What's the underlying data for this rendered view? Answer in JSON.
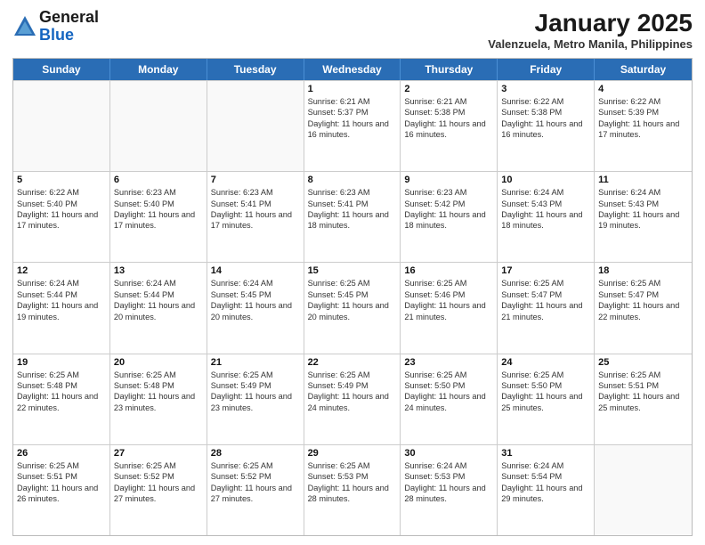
{
  "header": {
    "logo_line1": "General",
    "logo_line2": "Blue",
    "month_year": "January 2025",
    "location": "Valenzuela, Metro Manila, Philippines"
  },
  "days_of_week": [
    "Sunday",
    "Monday",
    "Tuesday",
    "Wednesday",
    "Thursday",
    "Friday",
    "Saturday"
  ],
  "weeks": [
    [
      {
        "day": "",
        "empty": true
      },
      {
        "day": "",
        "empty": true
      },
      {
        "day": "",
        "empty": true
      },
      {
        "day": "1",
        "sunrise": "6:21 AM",
        "sunset": "5:37 PM",
        "daylight": "11 hours and 16 minutes."
      },
      {
        "day": "2",
        "sunrise": "6:21 AM",
        "sunset": "5:38 PM",
        "daylight": "11 hours and 16 minutes."
      },
      {
        "day": "3",
        "sunrise": "6:22 AM",
        "sunset": "5:38 PM",
        "daylight": "11 hours and 16 minutes."
      },
      {
        "day": "4",
        "sunrise": "6:22 AM",
        "sunset": "5:39 PM",
        "daylight": "11 hours and 17 minutes."
      }
    ],
    [
      {
        "day": "5",
        "sunrise": "6:22 AM",
        "sunset": "5:40 PM",
        "daylight": "11 hours and 17 minutes."
      },
      {
        "day": "6",
        "sunrise": "6:23 AM",
        "sunset": "5:40 PM",
        "daylight": "11 hours and 17 minutes."
      },
      {
        "day": "7",
        "sunrise": "6:23 AM",
        "sunset": "5:41 PM",
        "daylight": "11 hours and 17 minutes."
      },
      {
        "day": "8",
        "sunrise": "6:23 AM",
        "sunset": "5:41 PM",
        "daylight": "11 hours and 18 minutes."
      },
      {
        "day": "9",
        "sunrise": "6:23 AM",
        "sunset": "5:42 PM",
        "daylight": "11 hours and 18 minutes."
      },
      {
        "day": "10",
        "sunrise": "6:24 AM",
        "sunset": "5:43 PM",
        "daylight": "11 hours and 18 minutes."
      },
      {
        "day": "11",
        "sunrise": "6:24 AM",
        "sunset": "5:43 PM",
        "daylight": "11 hours and 19 minutes."
      }
    ],
    [
      {
        "day": "12",
        "sunrise": "6:24 AM",
        "sunset": "5:44 PM",
        "daylight": "11 hours and 19 minutes."
      },
      {
        "day": "13",
        "sunrise": "6:24 AM",
        "sunset": "5:44 PM",
        "daylight": "11 hours and 20 minutes."
      },
      {
        "day": "14",
        "sunrise": "6:24 AM",
        "sunset": "5:45 PM",
        "daylight": "11 hours and 20 minutes."
      },
      {
        "day": "15",
        "sunrise": "6:25 AM",
        "sunset": "5:45 PM",
        "daylight": "11 hours and 20 minutes."
      },
      {
        "day": "16",
        "sunrise": "6:25 AM",
        "sunset": "5:46 PM",
        "daylight": "11 hours and 21 minutes."
      },
      {
        "day": "17",
        "sunrise": "6:25 AM",
        "sunset": "5:47 PM",
        "daylight": "11 hours and 21 minutes."
      },
      {
        "day": "18",
        "sunrise": "6:25 AM",
        "sunset": "5:47 PM",
        "daylight": "11 hours and 22 minutes."
      }
    ],
    [
      {
        "day": "19",
        "sunrise": "6:25 AM",
        "sunset": "5:48 PM",
        "daylight": "11 hours and 22 minutes."
      },
      {
        "day": "20",
        "sunrise": "6:25 AM",
        "sunset": "5:48 PM",
        "daylight": "11 hours and 23 minutes."
      },
      {
        "day": "21",
        "sunrise": "6:25 AM",
        "sunset": "5:49 PM",
        "daylight": "11 hours and 23 minutes."
      },
      {
        "day": "22",
        "sunrise": "6:25 AM",
        "sunset": "5:49 PM",
        "daylight": "11 hours and 24 minutes."
      },
      {
        "day": "23",
        "sunrise": "6:25 AM",
        "sunset": "5:50 PM",
        "daylight": "11 hours and 24 minutes."
      },
      {
        "day": "24",
        "sunrise": "6:25 AM",
        "sunset": "5:50 PM",
        "daylight": "11 hours and 25 minutes."
      },
      {
        "day": "25",
        "sunrise": "6:25 AM",
        "sunset": "5:51 PM",
        "daylight": "11 hours and 25 minutes."
      }
    ],
    [
      {
        "day": "26",
        "sunrise": "6:25 AM",
        "sunset": "5:51 PM",
        "daylight": "11 hours and 26 minutes."
      },
      {
        "day": "27",
        "sunrise": "6:25 AM",
        "sunset": "5:52 PM",
        "daylight": "11 hours and 27 minutes."
      },
      {
        "day": "28",
        "sunrise": "6:25 AM",
        "sunset": "5:52 PM",
        "daylight": "11 hours and 27 minutes."
      },
      {
        "day": "29",
        "sunrise": "6:25 AM",
        "sunset": "5:53 PM",
        "daylight": "11 hours and 28 minutes."
      },
      {
        "day": "30",
        "sunrise": "6:24 AM",
        "sunset": "5:53 PM",
        "daylight": "11 hours and 28 minutes."
      },
      {
        "day": "31",
        "sunrise": "6:24 AM",
        "sunset": "5:54 PM",
        "daylight": "11 hours and 29 minutes."
      },
      {
        "day": "",
        "empty": true
      }
    ]
  ]
}
